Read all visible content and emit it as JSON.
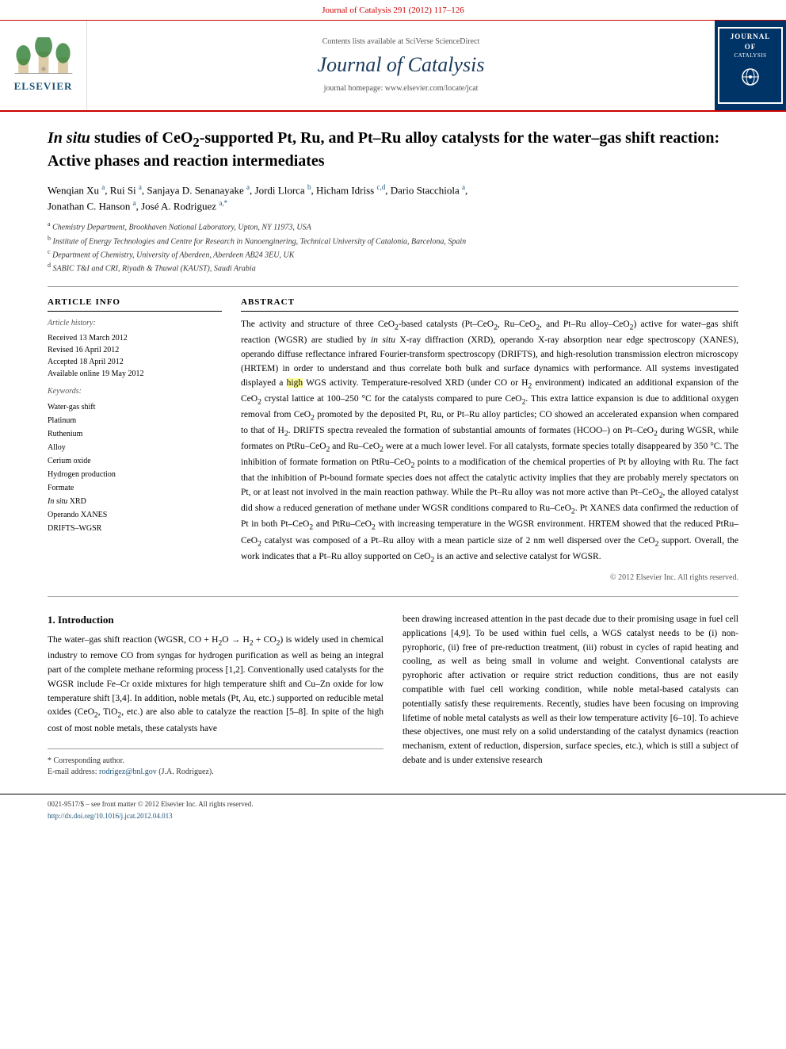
{
  "journal": {
    "top_header": "Journal of Catalysis 291 (2012) 117–126",
    "sciverse_line": "Contents lists available at SciVerse ScienceDirect",
    "sciverse_link": "SciVerse ScienceDirect",
    "main_title": "Journal of Catalysis",
    "homepage_line": "journal homepage: www.elsevier.com/locate/jcat",
    "logo_title": "JOURNAL OF",
    "logo_subtitle": "CATALYSIS",
    "elsevier_text": "ELSEVIER"
  },
  "article": {
    "title": "In situ studies of CeO₂-supported Pt, Ru, and Pt–Ru alloy catalysts for the water–gas shift reaction: Active phases and reaction intermediates",
    "title_prefix": "In situ",
    "title_rest": " studies of CeO₂-supported Pt, Ru, and Pt–Ru alloy catalysts for the water–gas shift reaction: Active phases and reaction intermediates"
  },
  "authors": {
    "list": "Wenqian Xu a, Rui Si a, Sanjaya D. Senanayake a, Jordi Llorca b, Hicham Idriss c,d, Dario Stacchiola a, Jonathan C. Hanson a, José A. Rodriguez a,*",
    "affiliations": [
      "a Chemistry Department, Brookhaven National Laboratory, Upton, NY 11973, USA",
      "b Institute of Energy Technologies and Centre for Research in Nanoenginering, Technical University of Catalonia, Barcelona, Spain",
      "c Department of Chemistry, University of Aberdeen, Aberdeen AB24 3EU, UK",
      "d SABIC T&I and CRI, Riyadh & Thuwal (KAUST), Saudi Arabia"
    ]
  },
  "article_info": {
    "section_label": "ARTICLE INFO",
    "history_label": "Article history:",
    "received": "Received 13 March 2012",
    "revised": "Revised 16 April 2012",
    "accepted": "Accepted 18 April 2012",
    "available": "Available online 19 May 2012",
    "keywords_label": "Keywords:",
    "keywords": [
      "Water-gas shift",
      "Platinum",
      "Ruthenium",
      "Alloy",
      "Cerium oxide",
      "Hydrogen production",
      "Formate",
      "In situ XRD",
      "Operando XANES",
      "DRIFTS–WGSR"
    ]
  },
  "abstract": {
    "section_label": "ABSTRACT",
    "text": "The activity and structure of three CeO₂-based catalysts (Pt–CeO₂, Ru–CeO₂, and Pt–Ru alloy–CeO₂) active for water–gas shift reaction (WGSR) are studied by in situ X-ray diffraction (XRD), operando X-ray absorption near edge spectroscopy (XANES), operando diffuse reflectance infrared Fourier-transform spectroscopy (DRIFTS), and high-resolution transmission electron microscopy (HRTEM) in order to understand and thus correlate both bulk and surface dynamics with performance. All systems investigated displayed a high WGS activity. Temperature-resolved XRD (under CO or H₂ environment) indicated an additional expansion of the CeO₂ crystal lattice at 100–250 °C for the catalysts compared to pure CeO₂. This extra lattice expansion is due to additional oxygen removal from CeO₂ promoted by the deposited Pt, Ru, or Pt–Ru alloy particles; CO showed an accelerated expansion when compared to that of H₂. DRIFTS spectra revealed the formation of substantial amounts of formates (HCOO–) on Pt–CeO₂ during WGSR, while formates on PtRu–CeO₂ and Ru–CeO₂ were at a much lower level. For all catalysts, formate species totally disappeared by 350 °C. The inhibition of formate formation on PtRu–CeO₂ points to a modification of the chemical properties of Pt by alloying with Ru. The fact that the inhibition of Pt-bound formate species does not affect the catalytic activity implies that they are probably merely spectators on Pt, or at least not involved in the main reaction pathway. While the Pt–Ru alloy was not more active than Pt–CeO₂, the alloyed catalyst did show a reduced generation of methane under WGSR conditions compared to Ru–CeO₂. Pt XANES data confirmed the reduction of Pt in both Pt–CeO₂ and PtRu–CeO₂ with increasing temperature in the WGSR environment. HRTEM showed that the reduced PtRu–CeO₂ catalyst was composed of a Pt–Ru alloy with a mean particle size of 2 nm well dispersed over the CeO₂ support. Overall, the work indicates that a Pt–Ru alloy supported on CeO₂ is an active and selective catalyst for WGSR.",
    "copyright": "© 2012 Elsevier Inc. All rights reserved."
  },
  "introduction": {
    "section_number": "1.",
    "section_title": "Introduction",
    "left_text": "The water–gas shift reaction (WGSR, CO + H₂O → H₂ + CO₂) is widely used in chemical industry to remove CO from syngas for hydrogen purification as well as being an integral part of the complete methane reforming process [1,2]. Conventionally used catalysts for the WGSR include Fe–Cr oxide mixtures for high temperature shift and Cu–Zn oxide for low temperature shift [3,4]. In addition, noble metals (Pt, Au, etc.) supported on reducible metal oxides (CeO₂, TiO₂, etc.) are also able to catalyze the reaction [5–8]. In spite of the high cost of most noble metals, these catalysts have",
    "right_text": "been drawing increased attention in the past decade due to their promising usage in fuel cell applications [4,9]. To be used within fuel cells, a WGS catalyst needs to be (i) non-pyrophoric, (ii) free of pre-reduction treatment, (iii) robust in cycles of rapid heating and cooling, as well as being small in volume and weight. Conventional catalysts are pyrophoric after activation or require strict reduction conditions, thus are not easily compatible with fuel cell working condition, while noble metal-based catalysts can potentially satisfy these requirements. Recently, studies have been focusing on improving lifetime of noble metal catalysts as well as their low temperature activity [6–10]. To achieve these objectives, one must rely on a solid understanding of the catalyst dynamics (reaction mechanism, extent of reduction, dispersion, surface species, etc.), which is still a subject of debate and is under extensive research"
  },
  "footnotes": {
    "corresponding": "* Corresponding author.",
    "email_label": "E-mail address:",
    "email": "rodrigez@bnl.gov",
    "email_suffix": "(J.A. Rodriguez)."
  },
  "bottom": {
    "issn": "0021-9517/$ – see front matter © 2012 Elsevier Inc. All rights reserved.",
    "doi": "http://dx.doi.org/10.1016/j.jcat.2012.04.013"
  },
  "highlighted_word": "high"
}
